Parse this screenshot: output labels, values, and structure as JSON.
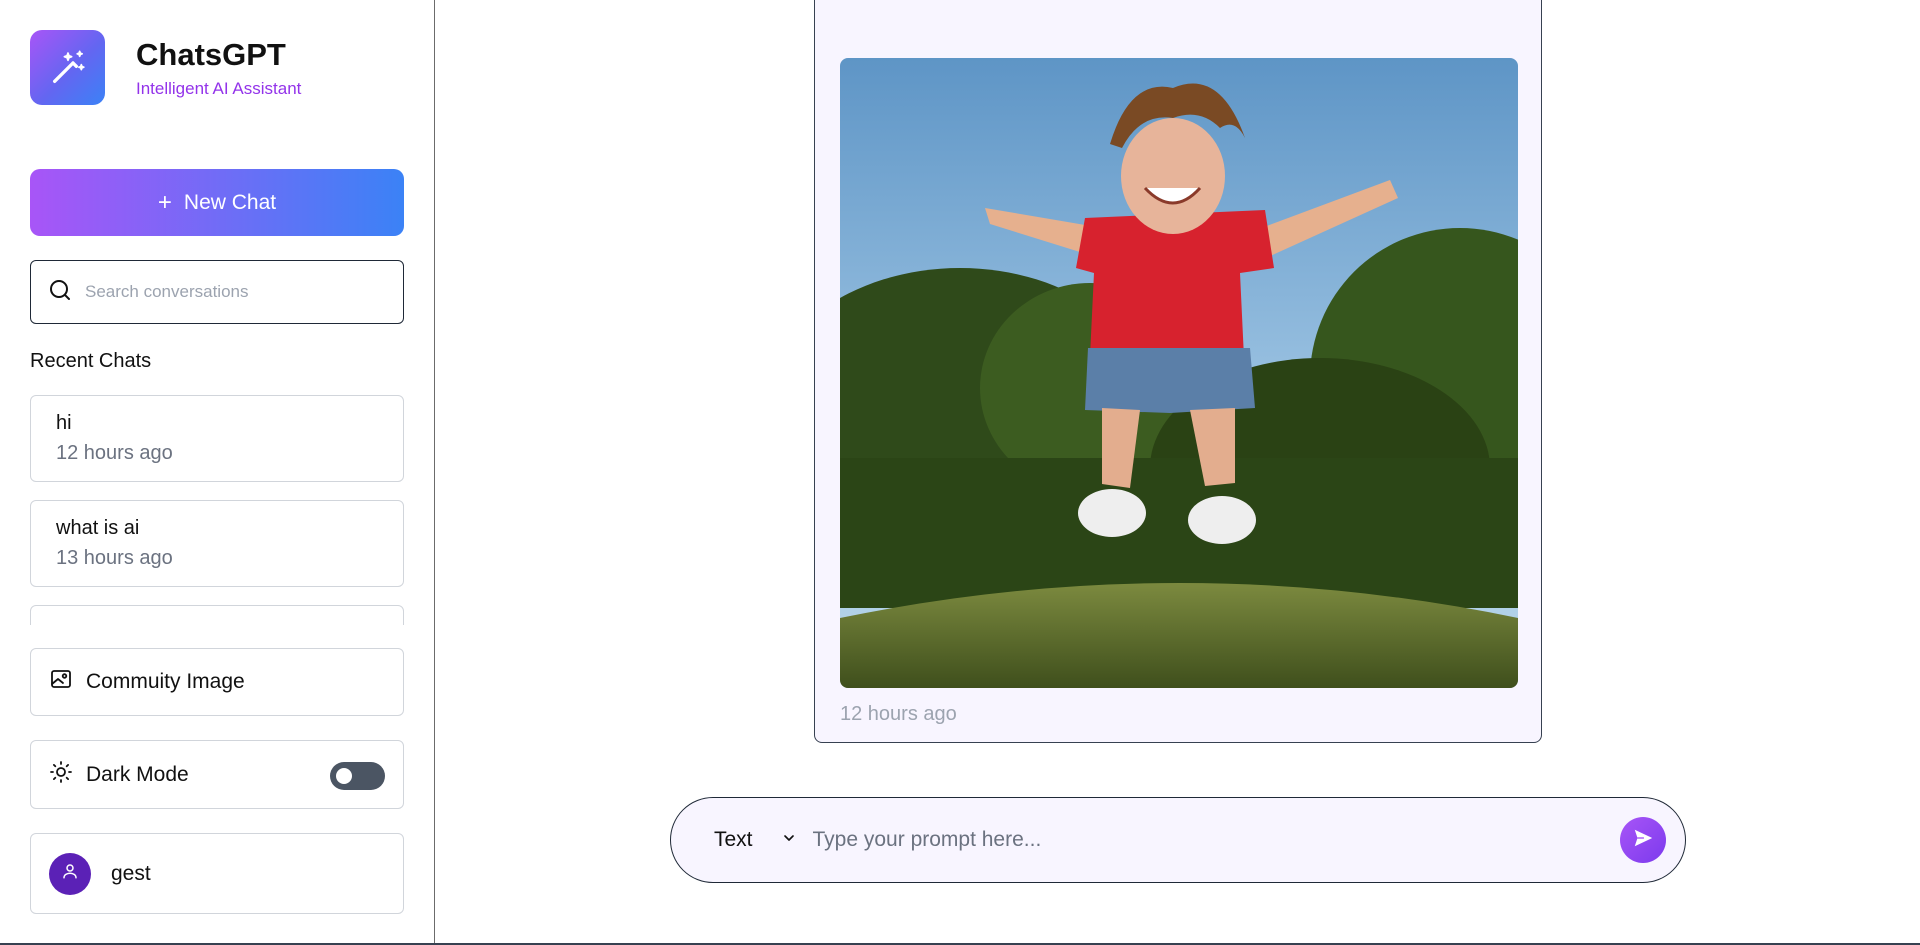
{
  "brand": {
    "title": "ChatsGPT",
    "subtitle": "Intelligent AI Assistant"
  },
  "sidebar": {
    "new_chat_label": "New Chat",
    "search_placeholder": "Search conversations",
    "recent_heading": "Recent Chats",
    "chats": [
      {
        "title": "hi",
        "time": "12 hours ago"
      },
      {
        "title": "what is ai",
        "time": "13 hours ago"
      }
    ],
    "community_label": "Commuity Image",
    "dark_mode_label": "Dark Mode",
    "dark_mode_enabled": false,
    "user_name": "gest"
  },
  "main": {
    "message": {
      "time": "12 hours ago"
    },
    "composer": {
      "mode_label": "Text",
      "placeholder": "Type your prompt here..."
    }
  },
  "icons": {
    "logo": "magic-wand-icon",
    "new_chat": "plus-icon",
    "search": "search-icon",
    "community": "image-icon",
    "dark_mode": "sun-icon",
    "user": "user-icon",
    "mode": "chevron-down-icon",
    "send": "send-icon"
  },
  "colors": {
    "accent_purple": "#a855f7",
    "accent_blue": "#3b82f6",
    "subtitle": "#9333ea",
    "avatar": "#5b21b6"
  }
}
